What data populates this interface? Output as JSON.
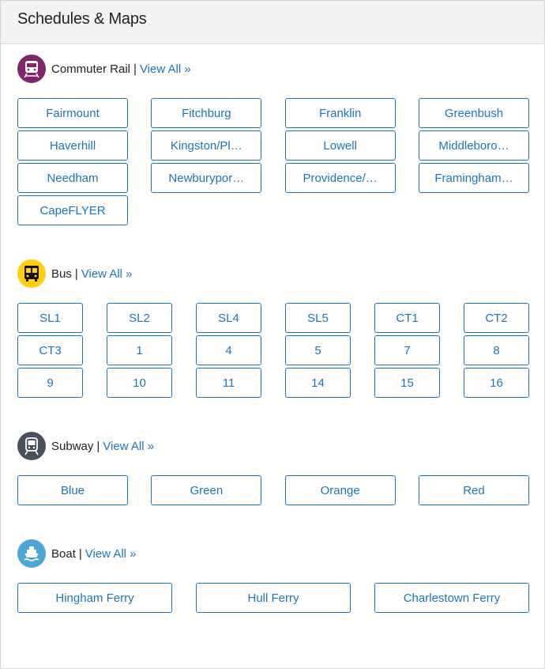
{
  "header": {
    "title": "Schedules & Maps"
  },
  "sections": {
    "commuter_rail": {
      "title": "Commuter Rail",
      "view_all": "View All »",
      "icon": "commuter-rail-icon",
      "icon_color": "#80276c",
      "routes": [
        "Fairmount",
        "Fitchburg",
        "Franklin",
        "Greenbush",
        "Haverhill",
        "Kingston/Pl…",
        "Lowell",
        "Middleboro…",
        "Needham",
        "Newburypor…",
        "Providence/…",
        "Framingham…",
        "CapeFLYER"
      ]
    },
    "bus": {
      "title": "Bus",
      "view_all": "View All »",
      "icon": "bus-icon",
      "icon_color": "#ffce0c",
      "routes": [
        "SL1",
        "SL2",
        "SL4",
        "SL5",
        "CT1",
        "CT2",
        "CT3",
        "1",
        "4",
        "5",
        "7",
        "8",
        "9",
        "10",
        "11",
        "14",
        "15",
        "16"
      ]
    },
    "subway": {
      "title": "Subway",
      "view_all": "View All »",
      "icon": "subway-icon",
      "icon_color": "#494f5c",
      "routes": [
        "Blue",
        "Green",
        "Orange",
        "Red"
      ]
    },
    "boat": {
      "title": "Boat",
      "view_all": "View All »",
      "icon": "ferry-icon",
      "icon_color": "#4fa4d8",
      "routes": [
        "Hingham Ferry",
        "Hull Ferry",
        "Charlestown Ferry"
      ]
    }
  },
  "colors": {
    "link": "#1c75bc",
    "header_bg": "#f3f3f3"
  }
}
